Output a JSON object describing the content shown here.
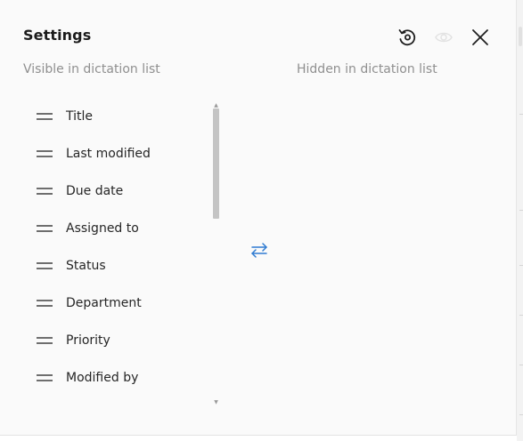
{
  "dialog": {
    "title": "Settings",
    "visible_column_label": "Visible in dictation list",
    "hidden_column_label": "Hidden in dictation list"
  },
  "header_icons": {
    "reset": "history-reset-icon",
    "visibility": "eye-icon",
    "close": "close-icon"
  },
  "visible_items": [
    {
      "label": "Title"
    },
    {
      "label": "Last modified"
    },
    {
      "label": "Due date"
    },
    {
      "label": "Assigned to"
    },
    {
      "label": "Status"
    },
    {
      "label": "Department"
    },
    {
      "label": "Priority"
    },
    {
      "label": "Modified by"
    }
  ],
  "hidden_items": [],
  "colors": {
    "accent": "#2f7bd1",
    "panel_bg": "#fafafa",
    "muted_text": "#8f8f8f"
  }
}
